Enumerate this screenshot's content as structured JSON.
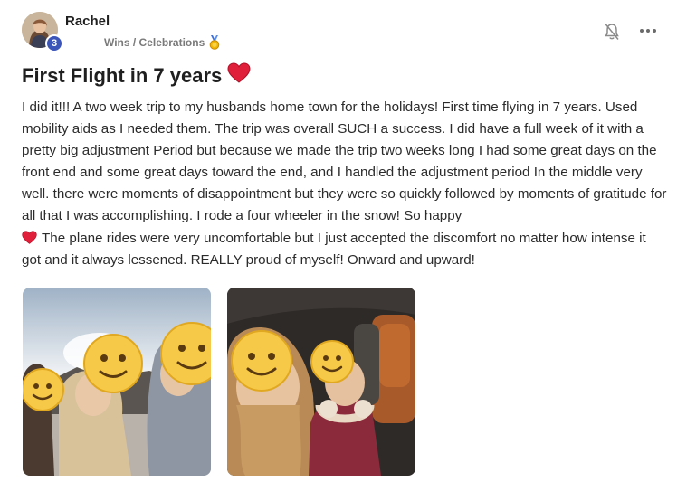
{
  "post": {
    "author": "Rachel",
    "level": "3",
    "category": "Wins / Celebrations",
    "category_icon": "medal-icon",
    "title": "First Flight in 7 years",
    "title_icon": "heart-icon",
    "body_part1": "I did it!!! A two week trip to my husbands home town for the holidays! First time flying in 7 years. Used mobility aids as I needed them. The trip was overall SUCH a success. I did have a full week of it with a pretty big adjustment Period but because we made the trip two weeks long I had some great days on the front end and some great days toward the end, and I handled the adjustment period In the middle very well. there were moments of disappointment but they were so quickly followed by moments of gratitude for all that I was accomplishing. I rode a four wheeler in the snow! So happy",
    "body_part2": "The plane rides were very uncomfortable but I just accepted the discomfort no matter how intense it got and it always lessened. REALLY proud of myself! Onward and upward!"
  },
  "actions": {
    "notify_icon": "bell-slash-icon",
    "more_icon": "more-options-icon"
  },
  "photos": [
    {
      "name": "photo-snow-selfie"
    },
    {
      "name": "photo-plane-selfie"
    }
  ],
  "colors": {
    "badge": "#3c55b8",
    "heart": "#e0203a",
    "muted": "#7a7a7a"
  }
}
